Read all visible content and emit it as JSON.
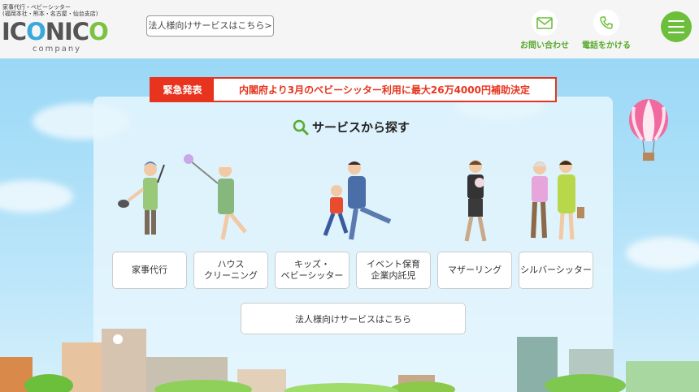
{
  "header": {
    "tagline_line1": "家事代行・ベビーシッター",
    "tagline_line2": "(福岡本社・熊本・名古屋・仙台支店)",
    "logo_text_a": "IC",
    "logo_o1": "O",
    "logo_text_b": "NIC",
    "logo_o2": "O",
    "company": "company",
    "corp_link": "法人様向けサービスはこちら>",
    "contact_label": "お問い合わせ",
    "phone_label": "電話をかける"
  },
  "notice": {
    "tag": "緊急発表",
    "message": "内閣府より3月のベビーシッター利用に最大26万4000円補助決定"
  },
  "section_title": "サービスから探す",
  "services": [
    {
      "label": "家事代行"
    },
    {
      "label": "ハウス\nクリーニング"
    },
    {
      "label": "キッズ・\nベビーシッター"
    },
    {
      "label": "イベント保育\n企業内託児"
    },
    {
      "label": "マザーリング"
    },
    {
      "label": "シルバーシッター"
    }
  ],
  "corp_button": "法人様向けサービスはこちら",
  "colors": {
    "accent_green": "#6cbf3a",
    "alert_red": "#e8341e",
    "logo_blue": "#3aa8dc"
  }
}
